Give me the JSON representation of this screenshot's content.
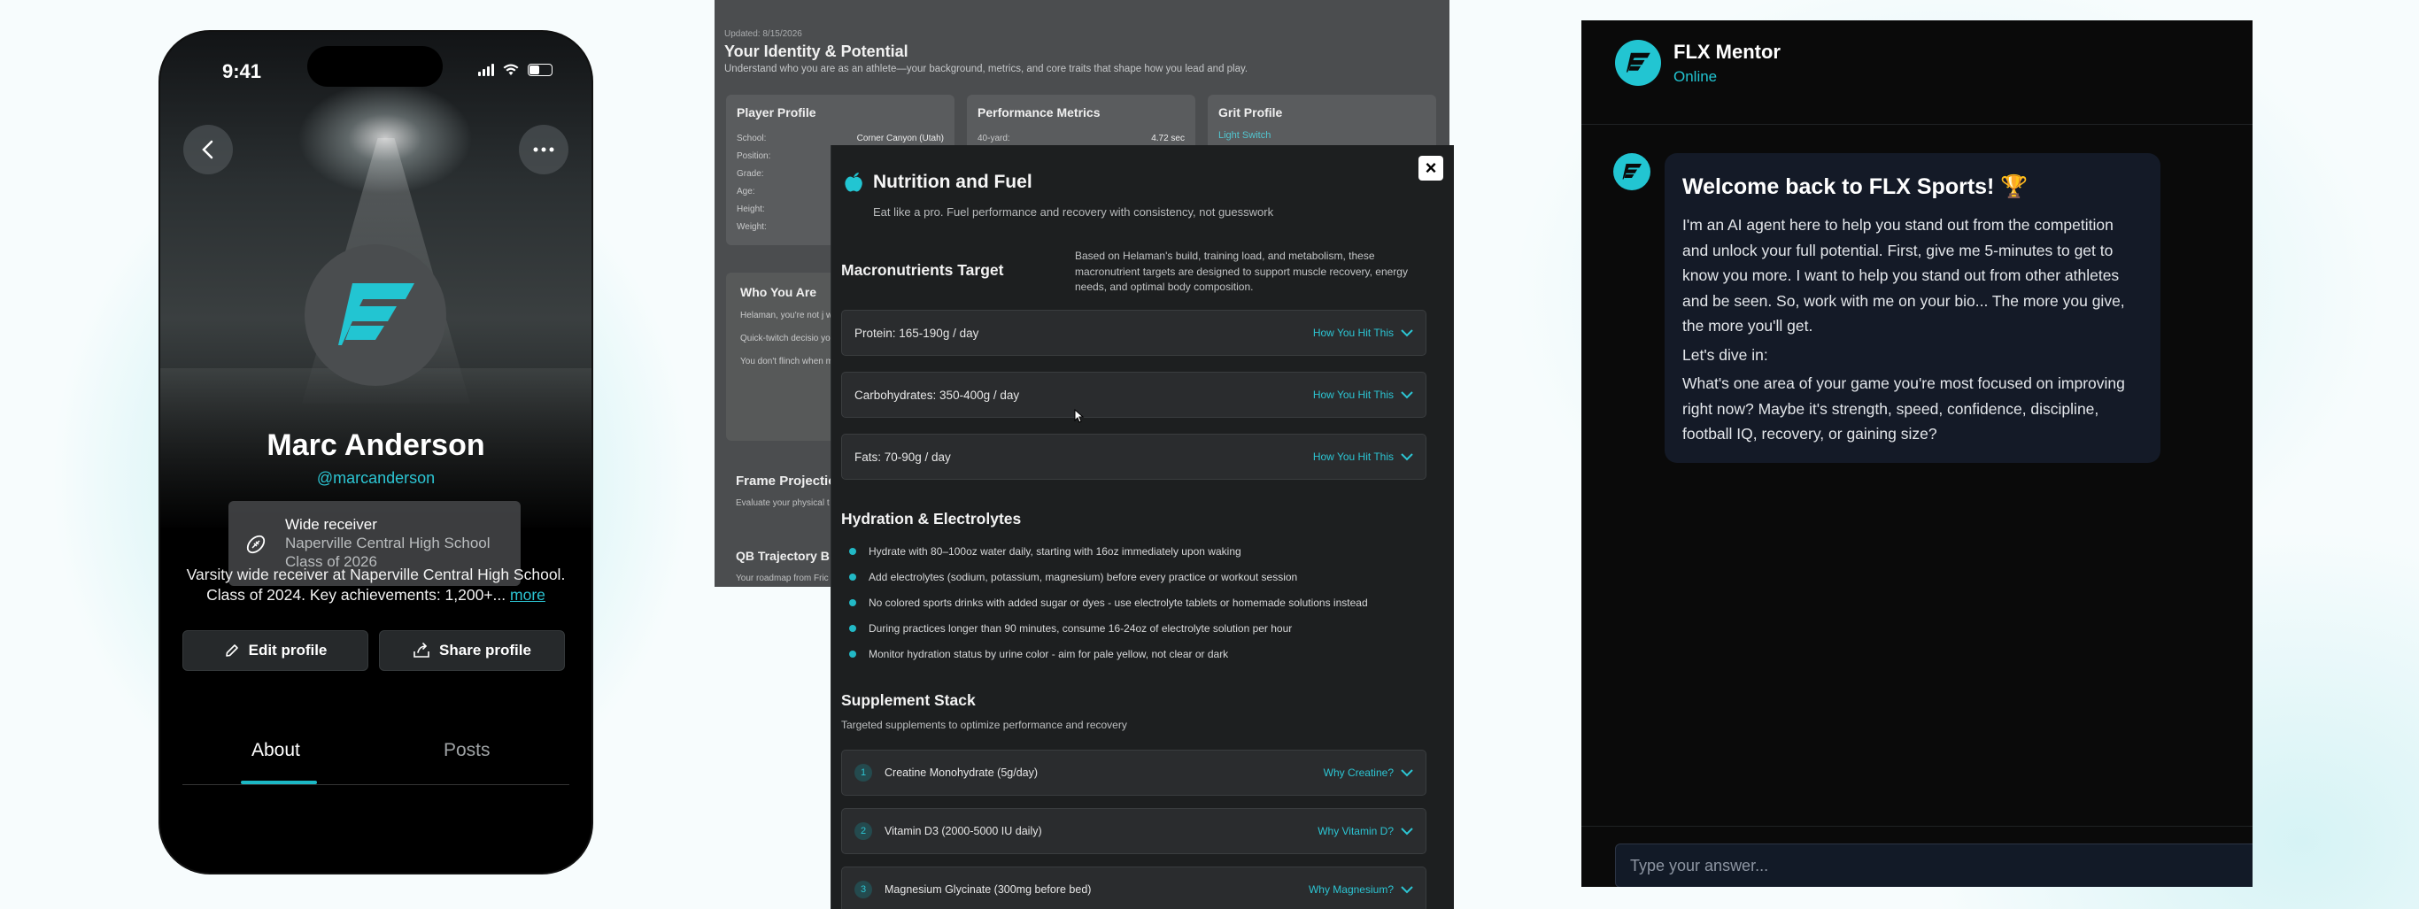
{
  "phone": {
    "time": "9:41",
    "name": "Marc Anderson",
    "handle": "@marcanderson",
    "position": {
      "title": "Wide receiver",
      "school": "Naperville Central High School",
      "class": "Class of 2026"
    },
    "bio": "Varsity wide receiver at Naperville Central High School. Class of 2024. Key achievements: 1,200+...",
    "bio_more": "more",
    "edit_button": "Edit profile",
    "share_button": "Share profile",
    "tabs": [
      "About",
      "Posts"
    ],
    "active_tab": "About",
    "icons": {
      "back": "back-arrow-icon",
      "more": "more-dots-icon",
      "position": "football-icon",
      "edit": "pencil-icon",
      "share": "share-icon"
    }
  },
  "identity": {
    "updated": "Updated: 8/15/2026",
    "title": "Your Identity & Potential",
    "subtitle": "Understand who you are as an athlete—your background, metrics, and core traits that shape how you lead and play.",
    "player_profile": {
      "title": "Player Profile",
      "rows": [
        {
          "label": "School:",
          "value": "Corner Canyon (Utah)"
        },
        {
          "label": "Position:",
          "value": ""
        },
        {
          "label": "Grade:",
          "value": ""
        },
        {
          "label": "Age:",
          "value": ""
        },
        {
          "label": "Height:",
          "value": ""
        },
        {
          "label": "Weight:",
          "value": ""
        }
      ]
    },
    "performance_metrics": {
      "title": "Performance Metrics",
      "rows": [
        {
          "label": "40-yard:",
          "value": "4.72 sec"
        }
      ]
    },
    "grit_profile": {
      "title": "Grit Profile",
      "link": "Light Switch"
    },
    "who_you_are": {
      "title": "Who You Are",
      "paragraphs": [
        "Helaman, you're not j who processes inforn",
        "Quick-twitch decisio you're rarely rattled b",
        "You don't flinch when mechanics are clean"
      ]
    },
    "frame_projection": {
      "title": "Frame Projectio",
      "subtitle": "Evaluate your physical t"
    },
    "qb_trajectory": {
      "title": "QB Trajectory B",
      "subtitle": "Your roadmap from Fric"
    }
  },
  "nutrition": {
    "title": "Nutrition and Fuel",
    "subtitle": "Eat like a pro. Fuel performance and recovery with consistency, not guesswork",
    "close_label": "×",
    "macros": {
      "title": "Macronutrients Target",
      "description": "Based on Helaman's build, training load, and metabolism, these macronutrient targets are designed to support muscle recovery, energy needs, and optimal body composition.",
      "items": [
        {
          "label": "Protein: 165-190g / day",
          "action": "How You Hit This"
        },
        {
          "label": "Carbohydrates: 350-400g / day",
          "action": "How You Hit This"
        },
        {
          "label": "Fats: 70-90g / day",
          "action": "How You Hit This"
        }
      ]
    },
    "hydration": {
      "title": "Hydration & Electrolytes",
      "items": [
        "Hydrate with 80–100oz water daily, starting with 16oz immediately upon waking",
        "Add electrolytes (sodium, potassium, magnesium) before every practice or workout session",
        "No colored sports drinks with added sugar or dyes - use electrolyte tablets or homemade solutions instead",
        "During practices longer than 90 minutes, consume 16-24oz of electrolyte solution per hour",
        "Monitor hydration status by urine color - aim for pale yellow, not clear or dark"
      ]
    },
    "supplements": {
      "title": "Supplement Stack",
      "subtitle": "Targeted supplements to optimize performance and recovery",
      "items": [
        {
          "num": "1",
          "label": "Creatine Monohydrate (5g/day)",
          "action": "Why Creatine?"
        },
        {
          "num": "2",
          "label": "Vitamin D3 (2000-5000 IU daily)",
          "action": "Why Vitamin D?"
        },
        {
          "num": "3",
          "label": "Magnesium Glycinate (300mg before bed)",
          "action": "Why Magnesium?"
        }
      ]
    }
  },
  "chat": {
    "name": "FLX Mentor",
    "status": "Online",
    "message": {
      "heading": "Welcome back to FLX Sports! 🏆",
      "paragraphs": [
        "I'm an AI agent here to help you stand out from the competition and unlock your full potential. First, give me 5-minutes to get to know you more. I want to help you stand out from other athletes and be seen. So, work with me on your bio... The more you give, the more you'll get.",
        "Let's dive in:",
        "What's one area of your game you're most focused on improving right now? Maybe it's strength, speed, confidence, discipline, football IQ, recovery, or gaining size?"
      ]
    },
    "input_placeholder": "Type your answer...",
    "accent": "#22c5d2"
  }
}
